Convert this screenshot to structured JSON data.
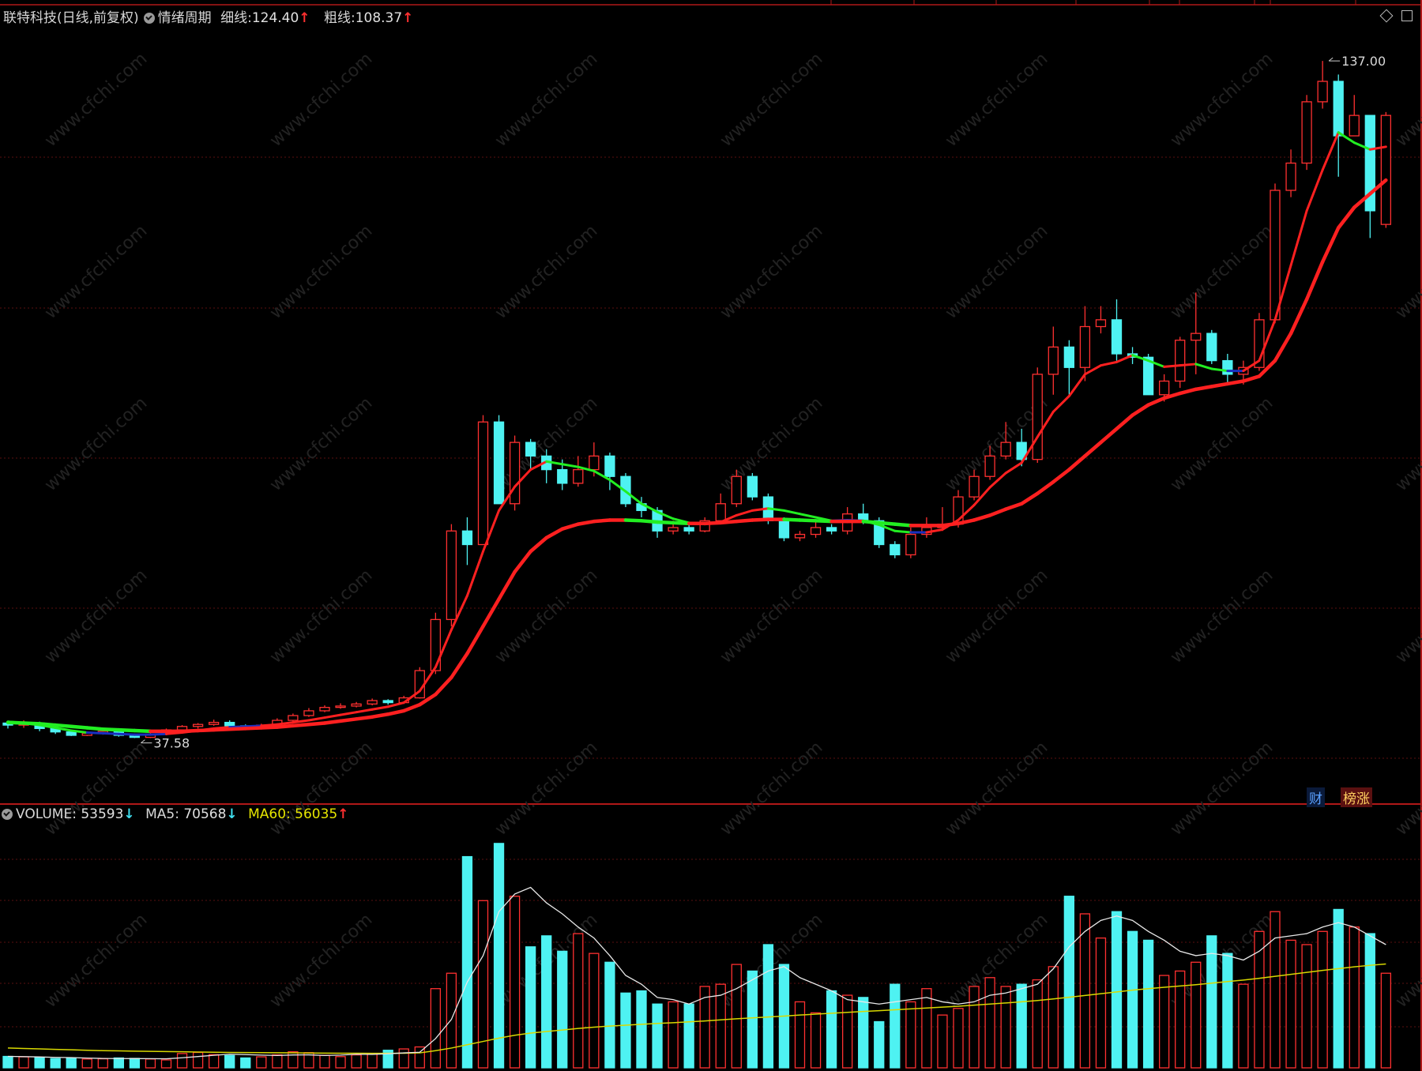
{
  "header": {
    "stock": "联特科技(日线,前复权)",
    "indicator": "情绪周期",
    "thin_label": "细线:",
    "thin_value": "124.40",
    "thick_label": "粗线:",
    "thick_value": "108.37",
    "arrow_up": "↑",
    "arrow_down": "↓"
  },
  "price_pane": {
    "high_label": "137.00",
    "low_label": "37.58",
    "buttons": {
      "finance": "财",
      "ranking": "榜涨"
    }
  },
  "volume_header": {
    "volume_label": "VOLUME:",
    "volume_value": "53593",
    "ma5_label": "MA5:",
    "ma5_value": "70568",
    "ma60_label": "MA60:",
    "ma60_value": "56035"
  },
  "colors": {
    "up": "#ff3030",
    "down": "#4ef2f2",
    "thin_line": "#ff2020",
    "thick_line": "#ff2020",
    "green_segment": "#22ee22",
    "blue_segment": "#1830c0",
    "ma5": "#e8e8e8",
    "ma60": "#d8d800",
    "grid": "#5a1010",
    "divider": "#b01818"
  },
  "chart_data": [
    {
      "type": "candlestick",
      "title": "联特科技(日线,前复权)",
      "ylim": [
        30,
        142
      ],
      "high_marker": 137.0,
      "low_marker": 37.58,
      "series": [
        {
          "name": "K",
          "values": [
            [
              39.8,
              39.5,
              40.1,
              39.0
            ],
            [
              39.5,
              39.8,
              40.2,
              39.1
            ],
            [
              39.8,
              39.0,
              40.0,
              38.6
            ],
            [
              39.0,
              38.5,
              39.2,
              38.2
            ],
            [
              38.5,
              38.0,
              38.6,
              37.9
            ],
            [
              38.0,
              38.3,
              38.5,
              37.9
            ],
            [
              38.3,
              38.6,
              38.9,
              38.1
            ],
            [
              38.6,
              38.0,
              38.8,
              37.8
            ],
            [
              38.0,
              37.7,
              38.2,
              37.6
            ],
            [
              37.7,
              38.2,
              38.4,
              37.6
            ],
            [
              38.2,
              38.8,
              39.0,
              38.0
            ],
            [
              38.8,
              39.3,
              39.5,
              38.6
            ],
            [
              39.3,
              39.6,
              39.8,
              39.0
            ],
            [
              39.6,
              39.9,
              40.3,
              39.4
            ],
            [
              39.9,
              39.4,
              40.2,
              39.2
            ],
            [
              39.4,
              39.1,
              39.6,
              38.9
            ],
            [
              39.1,
              39.5,
              39.7,
              38.9
            ],
            [
              39.5,
              40.2,
              40.5,
              39.3
            ],
            [
              40.2,
              40.9,
              41.2,
              40.0
            ],
            [
              40.9,
              41.6,
              42.0,
              40.7
            ],
            [
              41.6,
              42.1,
              42.4,
              41.4
            ],
            [
              42.1,
              42.3,
              42.7,
              41.9
            ],
            [
              42.3,
              42.6,
              42.9,
              42.1
            ],
            [
              42.6,
              43.1,
              43.4,
              42.4
            ],
            [
              43.1,
              42.8,
              43.3,
              42.5
            ],
            [
              42.8,
              43.5,
              43.8,
              42.6
            ],
            [
              43.5,
              47.5,
              48.0,
              43.4
            ],
            [
              47.5,
              55.0,
              56.0,
              47.0
            ],
            [
              55.0,
              68.0,
              69.0,
              54.0
            ],
            [
              68.0,
              66.0,
              70.0,
              63.0
            ],
            [
              66.0,
              84.0,
              85.0,
              66.0
            ],
            [
              84.0,
              72.0,
              85.0,
              72.0
            ],
            [
              72.0,
              81.0,
              82.0,
              71.0
            ],
            [
              81.0,
              79.0,
              81.5,
              77.0
            ],
            [
              79.0,
              77.0,
              80.0,
              75.0
            ],
            [
              77.0,
              75.0,
              78.5,
              74.0
            ],
            [
              75.0,
              77.0,
              79.0,
              74.5
            ],
            [
              77.0,
              79.0,
              81.0,
              76.0
            ],
            [
              79.0,
              76.0,
              79.5,
              74.0
            ],
            [
              76.0,
              72.0,
              76.5,
              71.5
            ],
            [
              72.0,
              71.0,
              73.0,
              70.0
            ],
            [
              71.0,
              68.0,
              71.5,
              67.0
            ],
            [
              68.0,
              68.5,
              69.5,
              67.5
            ],
            [
              68.5,
              68.0,
              69.0,
              67.5
            ],
            [
              68.0,
              69.5,
              70.0,
              67.8
            ],
            [
              69.5,
              72.0,
              73.5,
              69.0
            ],
            [
              72.0,
              76.0,
              77.0,
              71.5
            ],
            [
              76.0,
              73.0,
              76.5,
              72.5
            ],
            [
              73.0,
              69.5,
              73.5,
              69.0
            ],
            [
              69.5,
              67.0,
              70.0,
              66.5
            ],
            [
              67.0,
              67.5,
              68.0,
              66.5
            ],
            [
              67.5,
              68.5,
              69.5,
              67.0
            ],
            [
              68.5,
              68.0,
              69.0,
              67.5
            ],
            [
              68.0,
              70.5,
              71.5,
              67.5
            ],
            [
              70.5,
              69.5,
              72.0,
              69.0
            ],
            [
              69.5,
              66.0,
              70.0,
              65.5
            ],
            [
              66.0,
              64.5,
              66.5,
              64.0
            ],
            [
              64.5,
              67.5,
              68.5,
              64.0
            ],
            [
              67.5,
              68.5,
              70.0,
              67.0
            ],
            [
              68.5,
              69.0,
              71.5,
              68.0
            ],
            [
              69.0,
              73.0,
              74.0,
              68.5
            ],
            [
              73.0,
              76.0,
              77.0,
              72.5
            ],
            [
              76.0,
              79.0,
              80.5,
              75.5
            ],
            [
              79.0,
              81.0,
              84.0,
              78.5
            ],
            [
              81.0,
              78.5,
              83.0,
              77.5
            ],
            [
              78.5,
              91.0,
              92.0,
              78.0
            ],
            [
              91.0,
              95.0,
              98.0,
              88.0
            ],
            [
              95.0,
              92.0,
              96.0,
              88.0
            ],
            [
              92.0,
              98.0,
              101.0,
              90.0
            ],
            [
              98.0,
              99.0,
              101.0,
              97.0
            ],
            [
              99.0,
              94.0,
              102.0,
              93.0
            ],
            [
              94.0,
              93.5,
              95.0,
              92.5
            ],
            [
              93.5,
              88.0,
              94.0,
              88.0
            ],
            [
              88.0,
              90.0,
              91.0,
              87.0
            ],
            [
              90.0,
              96.0,
              96.5,
              89.0
            ],
            [
              96.0,
              97.0,
              103.0,
              91.0
            ],
            [
              97.0,
              93.0,
              97.5,
              92.5
            ],
            [
              93.0,
              91.0,
              94.0,
              89.5
            ],
            [
              91.0,
              92.0,
              93.0,
              89.5
            ],
            [
              92.0,
              99.0,
              100.0,
              91.5
            ],
            [
              99.0,
              118.0,
              119.0,
              98.5
            ],
            [
              118.0,
              122.0,
              124.0,
              117.0
            ],
            [
              122.0,
              131.0,
              132.0,
              121.0
            ],
            [
              131.0,
              134.0,
              137.0,
              130.0
            ],
            [
              134.0,
              126.0,
              135.0,
              120.0
            ],
            [
              126.0,
              129.0,
              132.0,
              126.0
            ],
            [
              129.0,
              115.0,
              122.0,
              111.0
            ],
            [
              113.0,
              129.0,
              129.5,
              112.5
            ]
          ]
        },
        {
          "name": "细线",
          "values": [
            40.0,
            39.8,
            39.5,
            39.1,
            38.7,
            38.4,
            38.3,
            38.2,
            38.1,
            38.1,
            38.2,
            38.4,
            38.7,
            39.0,
            39.2,
            39.3,
            39.4,
            39.6,
            39.9,
            40.2,
            40.6,
            41.0,
            41.4,
            41.8,
            42.2,
            42.8,
            44.5,
            48.0,
            53.5,
            58.5,
            65.0,
            71.0,
            74.5,
            77.0,
            78.2,
            77.8,
            77.4,
            76.8,
            75.5,
            73.8,
            72.0,
            70.8,
            69.8,
            69.2,
            69.0,
            69.3,
            70.3,
            71.0,
            71.3,
            71.0,
            70.5,
            70.0,
            69.5,
            69.6,
            69.5,
            68.9,
            68.0,
            67.8,
            67.8,
            68.2,
            69.6,
            71.8,
            74.4,
            76.5,
            78.0,
            81.8,
            85.5,
            87.8,
            91.0,
            92.3,
            92.8,
            93.8,
            93.0,
            92.1,
            92.3,
            92.5,
            91.8,
            91.5,
            91.5,
            93.0,
            99.0,
            107.0,
            115.0,
            121.0,
            126.5,
            125.0,
            124.0,
            124.4
          ]
        },
        {
          "name": "粗线",
          "values": [
            39.9,
            39.8,
            39.7,
            39.5,
            39.3,
            39.1,
            38.9,
            38.8,
            38.7,
            38.6,
            38.6,
            38.6,
            38.7,
            38.8,
            38.9,
            39.0,
            39.1,
            39.2,
            39.4,
            39.6,
            39.8,
            40.1,
            40.4,
            40.7,
            41.1,
            41.6,
            42.5,
            44.0,
            46.5,
            50.0,
            54.0,
            58.0,
            62.0,
            65.0,
            67.0,
            68.3,
            69.0,
            69.4,
            69.6,
            69.6,
            69.5,
            69.3,
            69.2,
            69.1,
            69.1,
            69.2,
            69.4,
            69.6,
            69.7,
            69.7,
            69.6,
            69.5,
            69.4,
            69.4,
            69.4,
            69.2,
            69.0,
            68.8,
            68.8,
            68.8,
            69.1,
            69.6,
            70.3,
            71.2,
            72.0,
            73.5,
            75.2,
            77.0,
            79.0,
            81.0,
            83.0,
            85.0,
            86.5,
            87.5,
            88.2,
            88.8,
            89.2,
            89.6,
            90.0,
            90.7,
            93.0,
            97.0,
            102.0,
            107.5,
            112.5,
            115.5,
            117.5,
            119.5
          ]
        }
      ]
    },
    {
      "type": "bar",
      "title": "VOLUME",
      "ylim": [
        0,
        112000
      ],
      "series": [
        {
          "name": "VOLUME",
          "values": [
            5200,
            5000,
            4700,
            4200,
            4300,
            4000,
            4100,
            4500,
            4300,
            4000,
            3600,
            6500,
            7000,
            6000,
            5600,
            4500,
            5000,
            5900,
            7300,
            6900,
            5700,
            5100,
            5900,
            6500,
            8000,
            8600,
            9500,
            36000,
            43000,
            96000,
            76000,
            102000,
            78000,
            55000,
            60000,
            53000,
            61000,
            52000,
            48000,
            34000,
            35000,
            29000,
            30000,
            29000,
            37000,
            38000,
            47000,
            44000,
            56000,
            47000,
            30000,
            25000,
            35000,
            33000,
            32000,
            21000,
            38000,
            30000,
            36000,
            24000,
            27000,
            37000,
            41000,
            37000,
            38000,
            40000,
            46000,
            78000,
            70000,
            59000,
            71000,
            62000,
            58000,
            42000,
            44000,
            48000,
            60000,
            52000,
            38000,
            62000,
            71000,
            58000,
            56000,
            62000,
            72000,
            64000,
            61000,
            43000
          ]
        },
        {
          "name": "MA5",
          "values": [
            5200,
            5100,
            4950,
            4750,
            4680,
            4440,
            4260,
            4220,
            4200,
            4180,
            4100,
            4580,
            5140,
            5700,
            6180,
            6000,
            5800,
            5600,
            5860,
            5900,
            5600,
            5800,
            6200,
            6100,
            6400,
            6800,
            7100,
            13300,
            22000,
            39000,
            51000,
            71000,
            79000,
            82000,
            75000,
            70000,
            64000,
            59000,
            51000,
            42000,
            38000,
            32000,
            31000,
            29000,
            32000,
            33000,
            36000,
            40000,
            44000,
            46000,
            41000,
            38000,
            35000,
            31000,
            30000,
            29000,
            30000,
            31000,
            32000,
            30000,
            29000,
            30000,
            33000,
            34000,
            36000,
            38000,
            45000,
            55000,
            62000,
            67000,
            69000,
            67000,
            62000,
            58000,
            53000,
            51000,
            52000,
            51000,
            49000,
            53000,
            59000,
            60000,
            61000,
            64000,
            66000,
            64000,
            60000,
            56000
          ]
        },
        {
          "name": "MA60",
          "values": [
            9000,
            8800,
            8600,
            8400,
            8200,
            8000,
            7800,
            7700,
            7600,
            7500,
            7400,
            7300,
            7200,
            7100,
            7000,
            6950,
            6900,
            6850,
            6800,
            6750,
            6700,
            6650,
            6650,
            6600,
            6600,
            6650,
            6800,
            7800,
            9000,
            10500,
            12000,
            13500,
            14800,
            15800,
            16500,
            17200,
            17900,
            18500,
            19000,
            19400,
            19800,
            20200,
            20500,
            20900,
            21300,
            21800,
            22300,
            22700,
            23100,
            23500,
            24000,
            24400,
            24800,
            25200,
            25600,
            26000,
            26400,
            26800,
            27200,
            27600,
            28000,
            28500,
            29000,
            29500,
            30000,
            30600,
            31300,
            32100,
            32900,
            33700,
            34500,
            35300,
            36000,
            36600,
            37200,
            37800,
            38500,
            39200,
            39900,
            40700,
            41600,
            42500,
            43400,
            44300,
            45100,
            45900,
            46600,
            47200
          ]
        }
      ]
    }
  ]
}
